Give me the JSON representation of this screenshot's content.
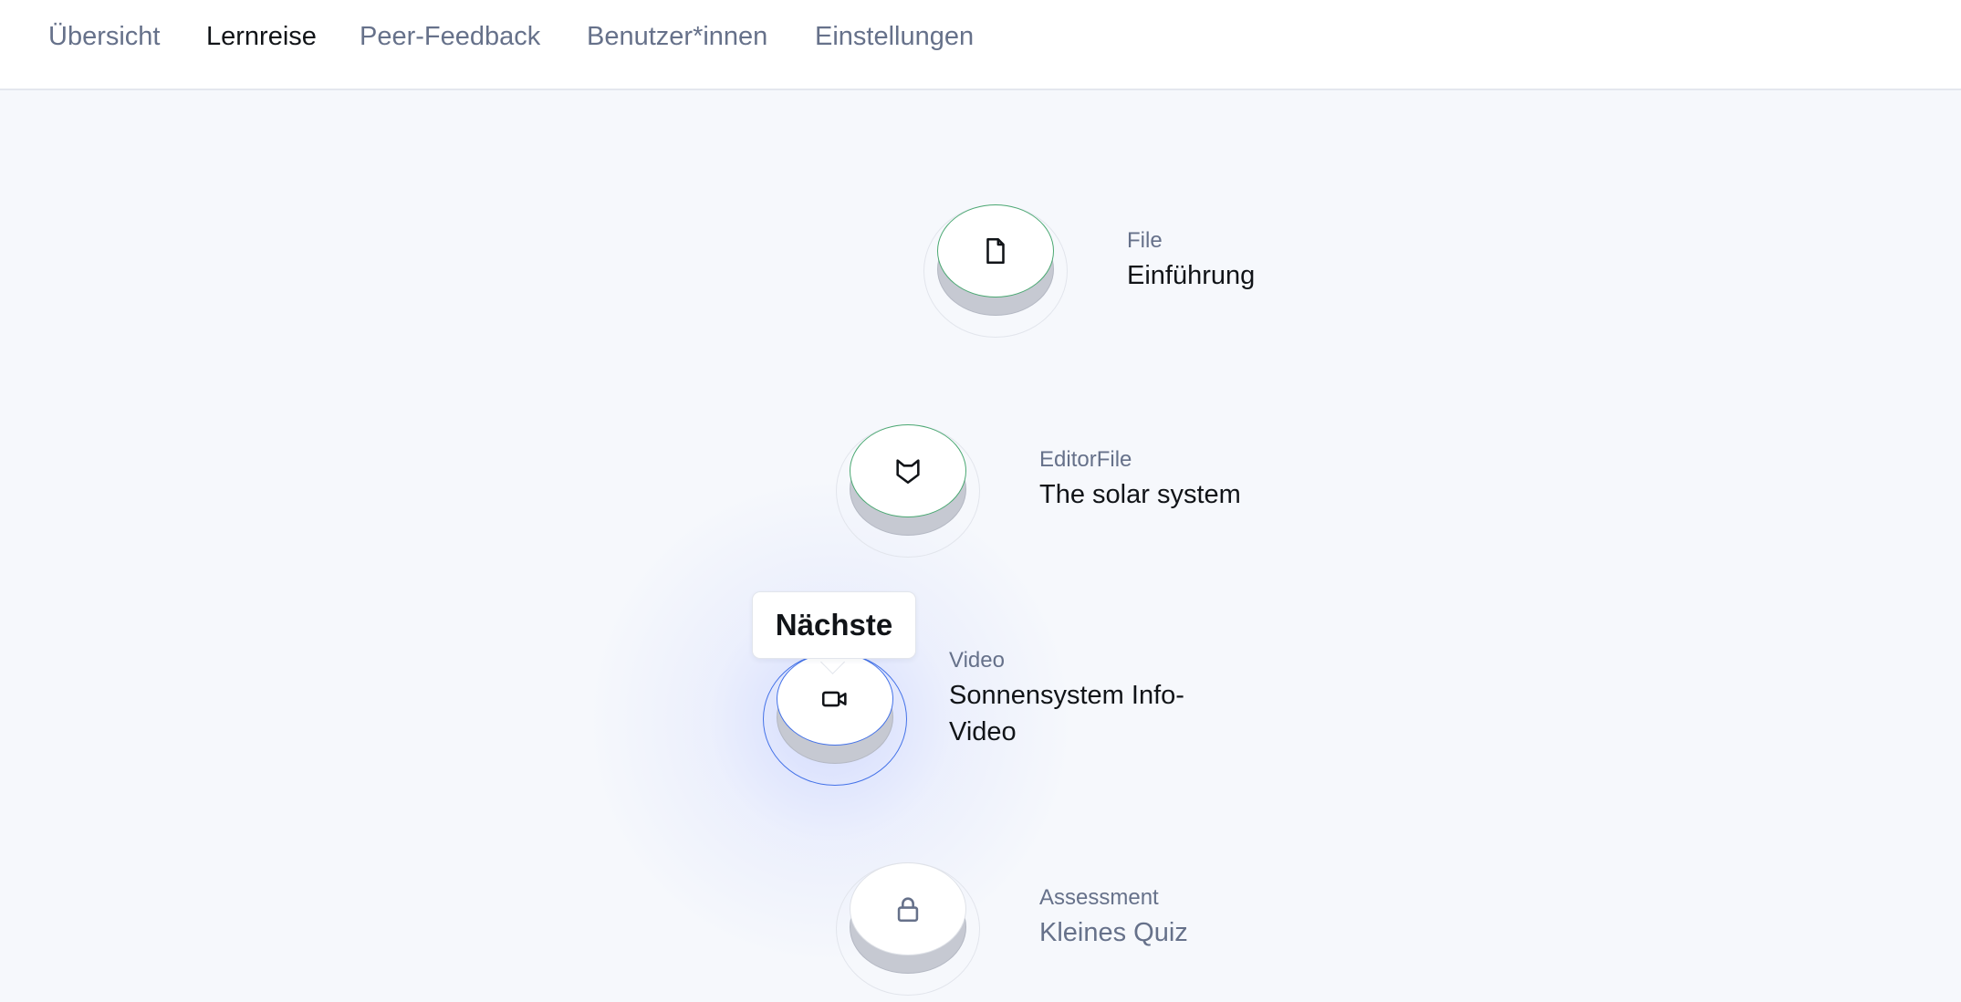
{
  "nav": {
    "tabs": [
      {
        "label": "Übersicht",
        "active": false
      },
      {
        "label": "Lernreise",
        "active": true
      },
      {
        "label": "Peer-Feedback",
        "active": false
      },
      {
        "label": "Benutzer*innen",
        "active": false
      },
      {
        "label": "Einstellungen",
        "active": false
      }
    ]
  },
  "journey": {
    "tooltip": "Nächste",
    "items": [
      {
        "type": "File",
        "title": "Einführung",
        "status": "done",
        "icon": "file-icon"
      },
      {
        "type": "EditorFile",
        "title": "The solar system",
        "status": "done",
        "icon": "fox-icon"
      },
      {
        "type": "Video",
        "title": "Sonnensystem Info-Video",
        "status": "current",
        "icon": "video-icon"
      },
      {
        "type": "Assessment",
        "title": "Kleines Quiz",
        "status": "locked",
        "icon": "lock-icon"
      }
    ]
  },
  "colors": {
    "done": "#4aa872",
    "current": "#4472e8",
    "muted": "#66718a",
    "text": "#111418"
  }
}
